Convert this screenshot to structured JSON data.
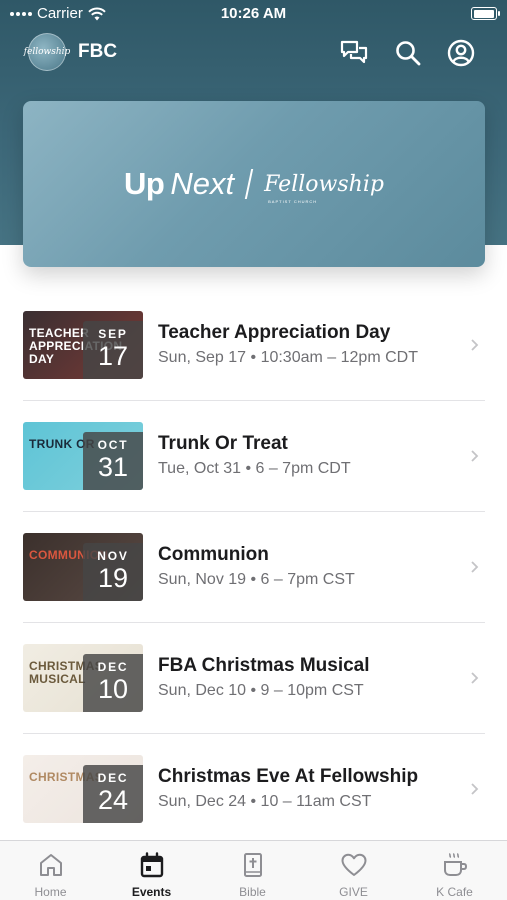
{
  "status_bar": {
    "carrier": "Carrier",
    "time": "10:26 AM",
    "battery_level": 1.0
  },
  "app_bar": {
    "logo_text": "fellowship",
    "title": "FBC",
    "icons": [
      "chat-icon",
      "search-icon",
      "account-icon"
    ]
  },
  "hero": {
    "up": "Up",
    "next": "Next",
    "logo_text": "Fellowship",
    "logo_sub": "BAPTIST CHURCH"
  },
  "events": [
    {
      "title": "Teacher Appreciation Day",
      "meta": "Sun, Sep 17 • 10:30am – 12pm CDT",
      "month": "SEP",
      "day": "17",
      "thumb_text": "TEACHER APPRECIATION DAY",
      "thumb_colors": [
        "#3a2f32",
        "#7a3a35"
      ],
      "thumb_text_color": "#ffffff"
    },
    {
      "title": "Trunk Or Treat",
      "meta": "Tue, Oct 31 • 6 – 7pm CDT",
      "month": "OCT",
      "day": "31",
      "thumb_text": "TRUNK OR",
      "thumb_colors": [
        "#5ec4d6",
        "#7fd0dc"
      ],
      "thumb_text_color": "#1a2a3a"
    },
    {
      "title": "Communion",
      "meta": "Sun, Nov 19 • 6 – 7pm CST",
      "month": "NOV",
      "day": "19",
      "thumb_text": "COMMUNION",
      "thumb_colors": [
        "#3b302c",
        "#5a4a44"
      ],
      "thumb_text_color": "#d9573f"
    },
    {
      "title": "FBA Christmas Musical",
      "meta": "Sun, Dec 10 • 9 – 10pm CST",
      "month": "DEC",
      "day": "10",
      "thumb_text": "CHRISTMAS MUSICAL",
      "thumb_colors": [
        "#f1ede3",
        "#e6e0d2"
      ],
      "thumb_text_color": "#6b5a3c"
    },
    {
      "title": "Christmas Eve At Fellowship",
      "meta": "Sun, Dec 24 • 10 – 11am CST",
      "month": "DEC",
      "day": "24",
      "thumb_text": "CHRISTMAS",
      "thumb_colors": [
        "#f4eee9",
        "#ece4de"
      ],
      "thumb_text_color": "#b08a63"
    }
  ],
  "tab_bar": {
    "tabs": [
      {
        "label": "Home",
        "icon": "home-icon"
      },
      {
        "label": "Events",
        "icon": "calendar-icon",
        "active": true
      },
      {
        "label": "Bible",
        "icon": "bible-icon"
      },
      {
        "label": "GIVE",
        "icon": "heart-icon"
      },
      {
        "label": "K Cafe",
        "icon": "coffee-icon"
      }
    ]
  },
  "colors": {
    "header_bg": "#3c6778",
    "hero_bg": "#6f9cae",
    "active_tab": "#1c1c1e",
    "inactive_tab": "#8e8e93"
  }
}
